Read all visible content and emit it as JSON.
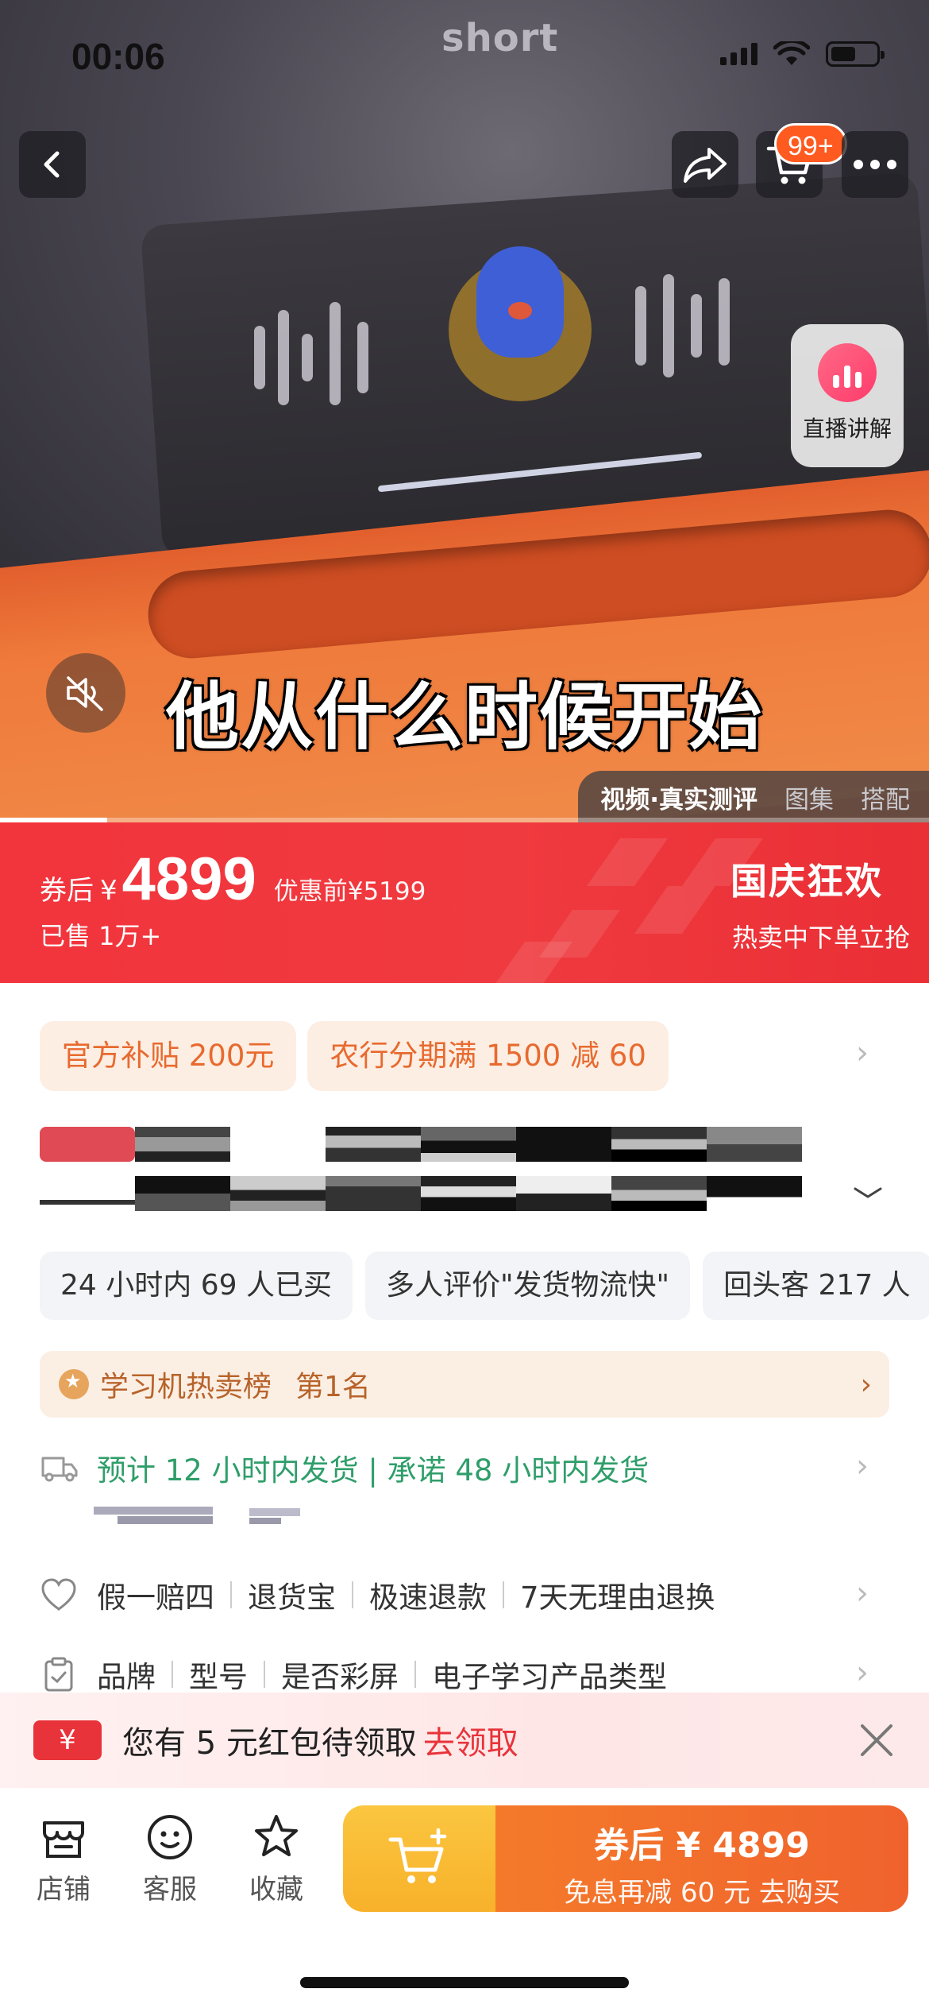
{
  "status_bar": {
    "time": "00:06"
  },
  "video": {
    "watermark": "short",
    "cart_badge": "99+",
    "live_label": "直播讲解",
    "subtitle": "他从什么时候开始",
    "media_tabs": [
      "视频·真实测评",
      "图集",
      "搭配"
    ],
    "progress_fraction": 0.115
  },
  "price": {
    "label": "券后",
    "currency": "¥",
    "amount": "4899",
    "original": "优惠前¥5199",
    "sold": "已售 1万+",
    "promo_title": "国庆狂欢",
    "promo_sub": "热卖中下单立抢"
  },
  "coupons": [
    "官方补贴 200元",
    "农行分期满 1500 减 60"
  ],
  "tags": [
    "24 小时内 69 人已买",
    "多人评价\"发货物流快\"",
    "回头客 217 人"
  ],
  "rank": {
    "part1": "学习机热卖榜",
    "part2": "第1名"
  },
  "shipping": "预计 12 小时内发货 | 承诺 48 小时内发货",
  "guarantees": [
    "假一赔四",
    "退货宝",
    "极速退款",
    "7天无理由退换"
  ],
  "params": [
    "品牌",
    "型号",
    "是否彩屏",
    "电子学习产品类型"
  ],
  "red_packet": {
    "icon": "¥",
    "text": "您有 5 元红包待领取",
    "action": "去领取"
  },
  "bottom_bar": {
    "store": "店铺",
    "service": "客服",
    "favorite": "收藏",
    "buy_line1": "券后 ¥ 4899",
    "buy_line2": "免息再减 60 元  去购买"
  },
  "colors": {
    "accent_red": "#f2343c",
    "accent_orange": "#f0622d",
    "accent_yellow": "#f8b12a",
    "green": "#2f9e6a"
  }
}
